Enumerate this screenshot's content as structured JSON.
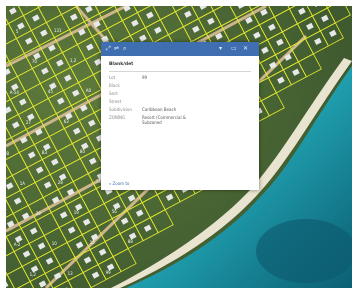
{
  "map": {
    "parcel_labels": [
      "A-4",
      "A-2",
      "1,2",
      "2B",
      "1A",
      "29",
      "10",
      "13",
      "C-2",
      "A-54",
      "27",
      "B3",
      "28",
      "19",
      "15",
      "99",
      "13",
      "5",
      "70",
      "45",
      "62",
      "80",
      "74",
      "56",
      "88",
      "114",
      "131",
      "1,2",
      "A0"
    ]
  },
  "popup": {
    "header_icons": [
      "expand-icon",
      "link-icon",
      "zoom-icon",
      "maximize-icon",
      "close-icon"
    ],
    "title": "Blank/det",
    "fields": [
      {
        "label": "Lot",
        "value": "99"
      },
      {
        "label": "Block",
        "value": ""
      },
      {
        "label": "Sect",
        "value": ""
      },
      {
        "label": "Street",
        "value": ""
      },
      {
        "label": "Subdivision",
        "value": "Caribbean Beach"
      },
      {
        "label": "ZONING",
        "value": "Resort (Commercial &\nSubzoned"
      }
    ],
    "zoom_label": "Zoom to"
  },
  "colors": {
    "header": "#3f6fb0",
    "parcel_line": "#e7ec2e",
    "sea": "#2aa7b8"
  }
}
